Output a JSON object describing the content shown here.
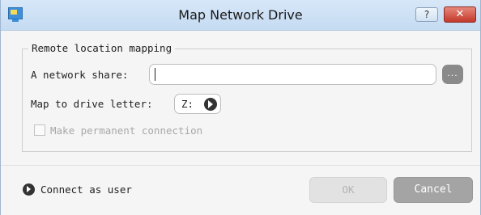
{
  "window": {
    "title": "Map Network Drive",
    "help_label": "?",
    "close_label": "✕"
  },
  "group": {
    "legend": "Remote location mapping",
    "share_label": "A network share:",
    "share_value": "",
    "browse_label": "...",
    "drive_label": "Map to drive letter:",
    "drive_value": "Z:",
    "permanent_label": "Make permanent connection",
    "permanent_checked": false
  },
  "footer": {
    "connect_label": "Connect as user",
    "ok_label": "OK",
    "cancel_label": "Cancel"
  },
  "colors": {
    "titlebar": "#c5dbf2",
    "close": "#c4392b",
    "cancel": "#a4a4a4",
    "ok_disabled": "#e2e2e2"
  }
}
